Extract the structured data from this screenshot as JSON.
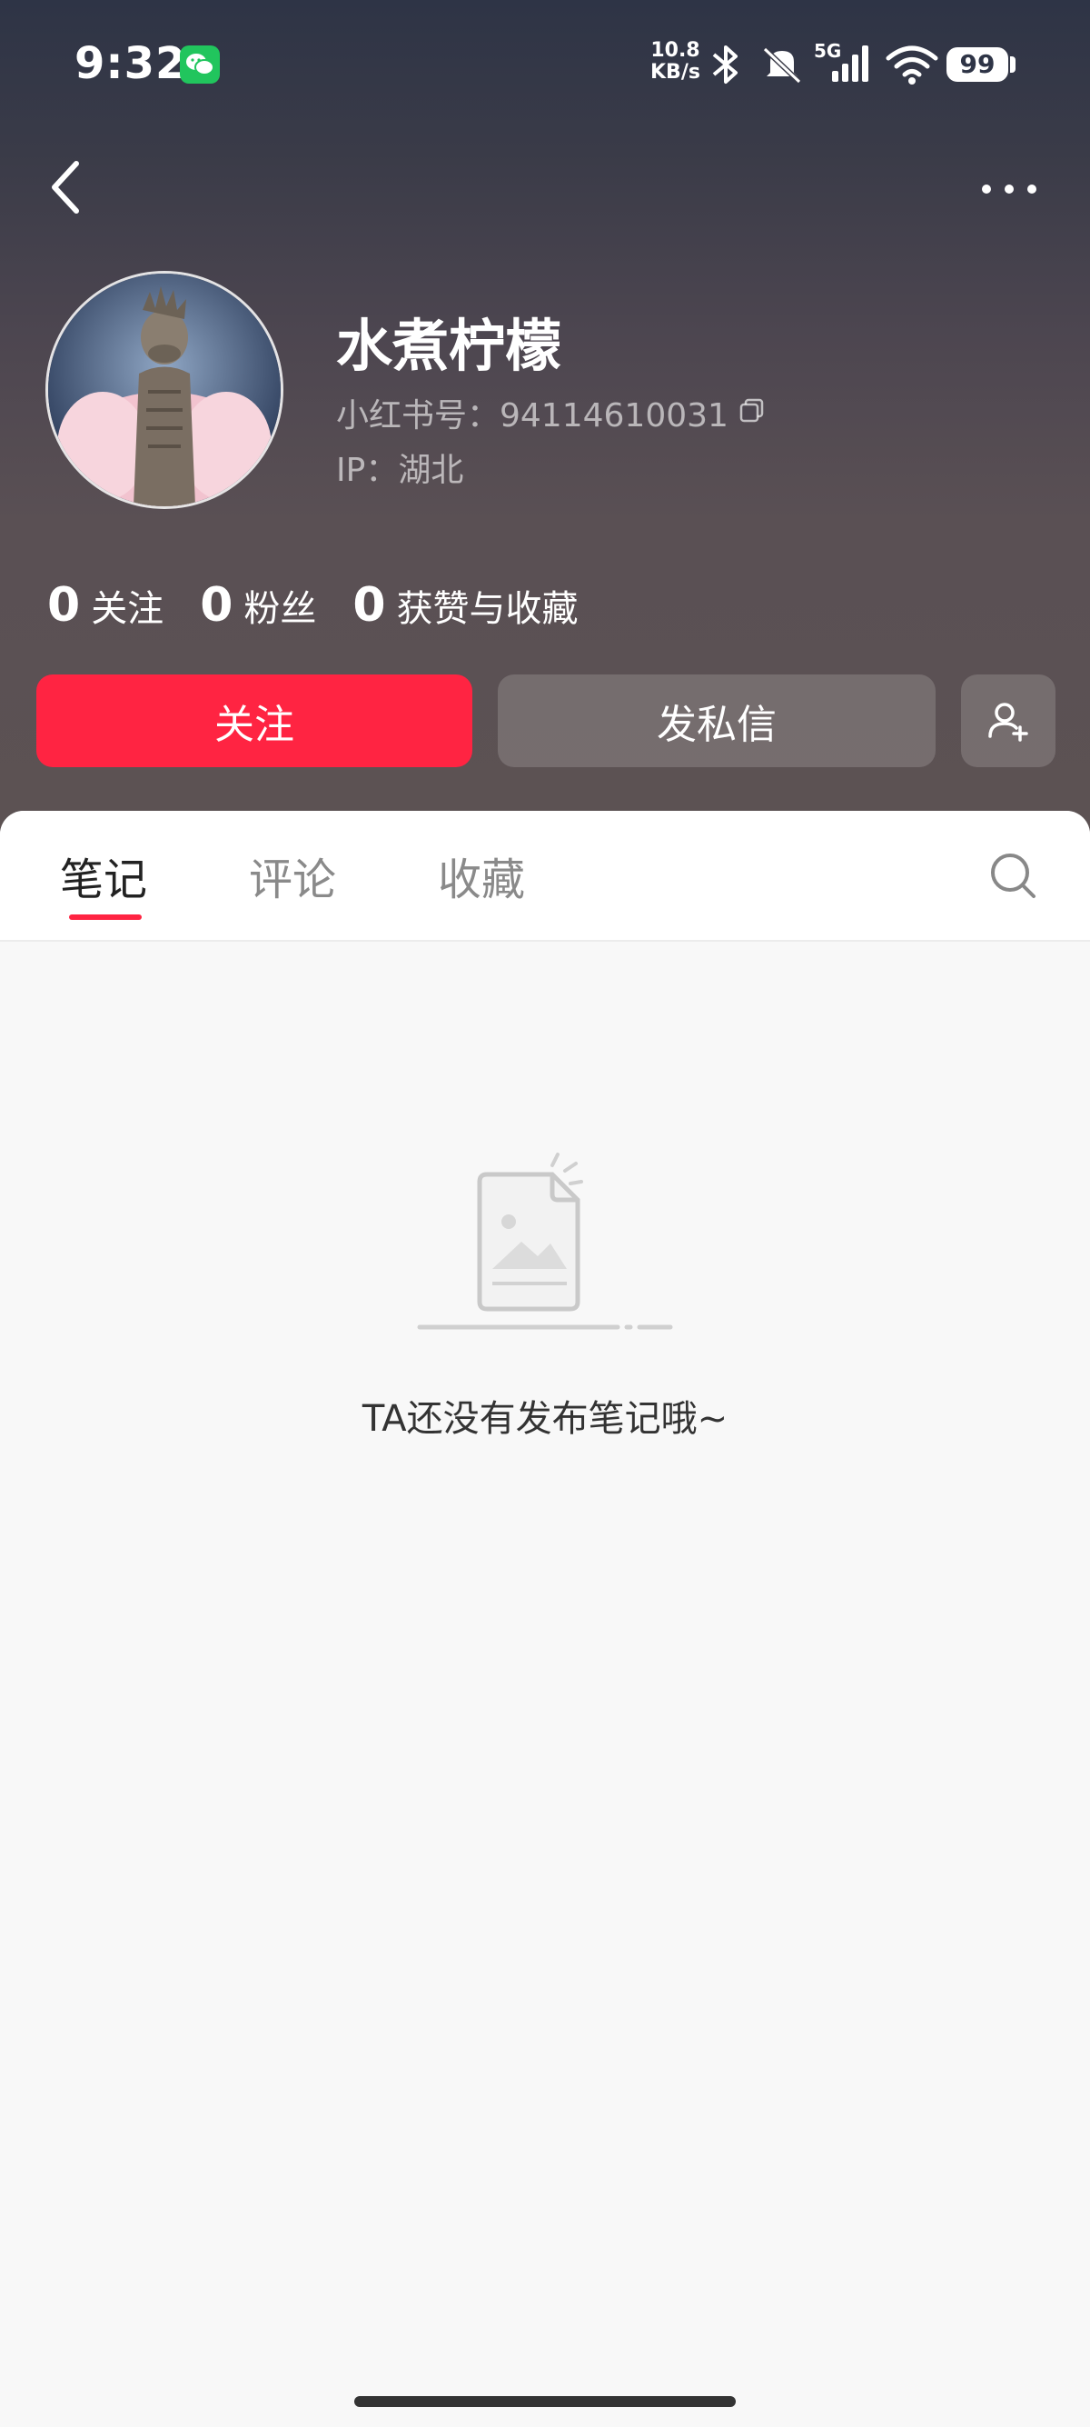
{
  "status_bar": {
    "time": "9:32",
    "net_speed_value": "10.8",
    "net_speed_unit": "KB/s",
    "network": "5G",
    "battery": "99",
    "icons": [
      "wechat-icon",
      "bluetooth-icon",
      "mute-icon",
      "signal-icon",
      "wifi-icon",
      "battery-icon"
    ]
  },
  "profile": {
    "name": "水煮柠檬",
    "id_text": "小红书号：94114610031",
    "ip_text": "IP：湖北"
  },
  "stats": [
    {
      "value": "0",
      "label": "关注"
    },
    {
      "value": "0",
      "label": "粉丝"
    },
    {
      "value": "0",
      "label": "获赞与收藏"
    }
  ],
  "actions": {
    "follow": "关注",
    "message": "发私信"
  },
  "tabs": [
    {
      "label": "笔记",
      "active": true
    },
    {
      "label": "评论",
      "active": false
    },
    {
      "label": "收藏",
      "active": false
    }
  ],
  "empty_state": {
    "text": "TA还没有发布笔记哦~"
  },
  "colors": {
    "accent": "#ff2442",
    "header_top": "#2e3446",
    "header_bottom": "#5c5253"
  }
}
